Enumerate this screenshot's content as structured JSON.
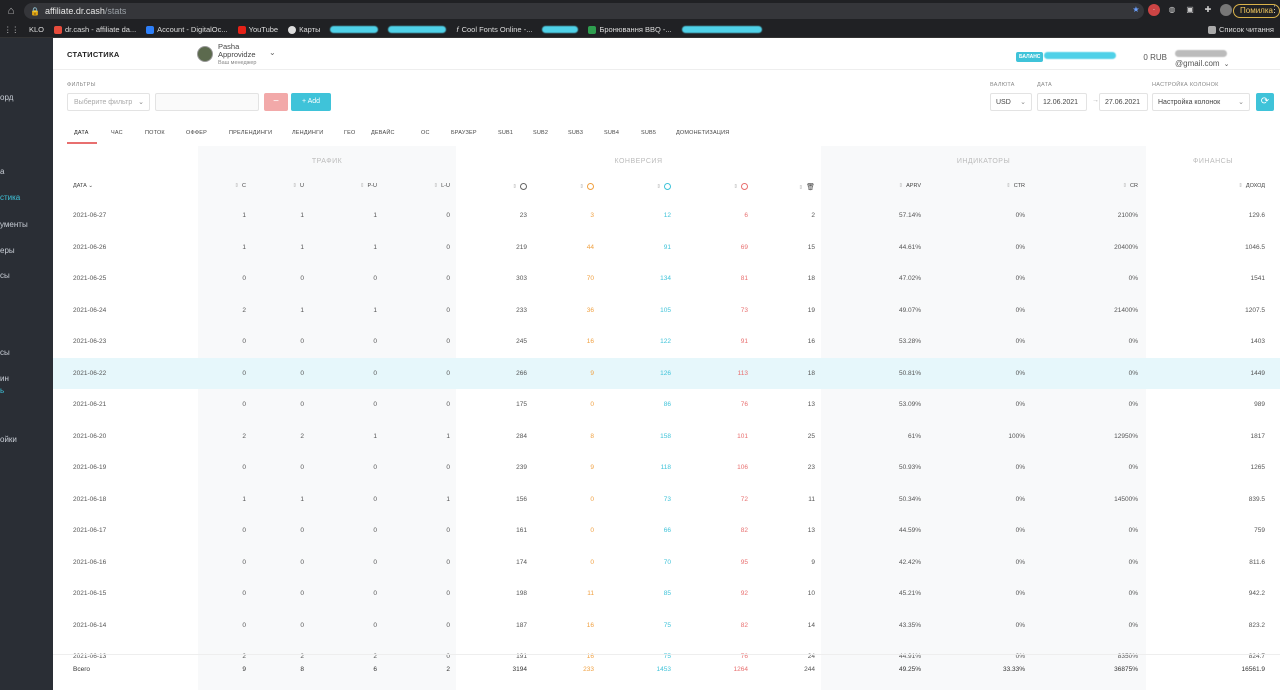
{
  "browser": {
    "url_host": "affiliate.dr.cash",
    "url_path": "/stats",
    "pause_label": "Помилка",
    "bookmarks": [
      "KLO",
      "dr.cash - affiliate da...",
      "Account - DigitalOc...",
      "YouTube",
      "Карты",
      "Cool Fonts Online -...",
      "Бронювання ВВQ -..."
    ],
    "reading_list": "Список читання"
  },
  "sidebar": {
    "items": [
      "орд",
      "а",
      "стика",
      "ументы",
      "еры",
      "сы",
      "сы",
      "ин",
      "ь",
      "ойки"
    ]
  },
  "header": {
    "title": "СТАТИСТИКА",
    "manager_name": "Pasha Approvidze",
    "manager_sub": "Ваш менеджер",
    "balance_label": "БАЛАНС",
    "balance_value": "0 RUB",
    "email": "@gmail.com"
  },
  "filters": {
    "label": "ФИЛЬТРЫ",
    "select_placeholder": "Выберите фильтр",
    "minus": "−",
    "add": "+ Add",
    "currency_label": "ВАЛЮТА",
    "currency_value": "USD",
    "date_label": "ДАТА",
    "date_from": "12.06.2021",
    "date_to": "27.06.2021",
    "columns_label": "НАСТРОЙКА КОЛОНОК",
    "columns_value": "Настройка колонок",
    "refresh": "⟳"
  },
  "tabs": [
    "ДАТА",
    "ЧАС",
    "ПОТОК",
    "ОФФЕР",
    "ПРЕЛЕНДИНГИ",
    "ЛЕНДИНГИ",
    "ГЕО",
    "ДЕВАЙС",
    "ОС",
    "БРАУЗЕР",
    "SUB1",
    "SUB2",
    "SUB3",
    "SUB4",
    "SUB5",
    "ДОМОНЕТИЗАЦИЯ"
  ],
  "table": {
    "groups": [
      "ТРАФИК",
      "КОНВЕРСИЯ",
      "ИНДИКАТОРЫ",
      "ФИНАНСЫ"
    ],
    "headers": [
      "ДАТА",
      "C",
      "U",
      "P-U",
      "L-U",
      "",
      "",
      "",
      "",
      "",
      "APRV",
      "CTR",
      "CR",
      "ДОХОД"
    ],
    "rows": [
      [
        "2021-06-27",
        "1",
        "1",
        "1",
        "0",
        "23",
        "3",
        "12",
        "6",
        "2",
        "57.14%",
        "0%",
        "2100%",
        "129.6"
      ],
      [
        "2021-06-26",
        "1",
        "1",
        "1",
        "0",
        "219",
        "44",
        "91",
        "69",
        "15",
        "44.61%",
        "0%",
        "20400%",
        "1046.5"
      ],
      [
        "2021-06-25",
        "0",
        "0",
        "0",
        "0",
        "303",
        "70",
        "134",
        "81",
        "18",
        "47.02%",
        "0%",
        "0%",
        "1541"
      ],
      [
        "2021-06-24",
        "2",
        "1",
        "1",
        "0",
        "233",
        "36",
        "105",
        "73",
        "19",
        "49.07%",
        "0%",
        "21400%",
        "1207.5"
      ],
      [
        "2021-06-23",
        "0",
        "0",
        "0",
        "0",
        "245",
        "16",
        "122",
        "91",
        "16",
        "53.28%",
        "0%",
        "0%",
        "1403"
      ],
      [
        "2021-06-22",
        "0",
        "0",
        "0",
        "0",
        "266",
        "9",
        "126",
        "113",
        "18",
        "50.81%",
        "0%",
        "0%",
        "1449"
      ],
      [
        "2021-06-21",
        "0",
        "0",
        "0",
        "0",
        "175",
        "0",
        "86",
        "76",
        "13",
        "53.09%",
        "0%",
        "0%",
        "989"
      ],
      [
        "2021-06-20",
        "2",
        "2",
        "1",
        "1",
        "284",
        "8",
        "158",
        "101",
        "25",
        "61%",
        "100%",
        "12950%",
        "1817"
      ],
      [
        "2021-06-19",
        "0",
        "0",
        "0",
        "0",
        "239",
        "9",
        "118",
        "106",
        "23",
        "50.93%",
        "0%",
        "0%",
        "1265"
      ],
      [
        "2021-06-18",
        "1",
        "1",
        "0",
        "1",
        "156",
        "0",
        "73",
        "72",
        "11",
        "50.34%",
        "0%",
        "14500%",
        "839.5"
      ],
      [
        "2021-06-17",
        "0",
        "0",
        "0",
        "0",
        "161",
        "0",
        "66",
        "82",
        "13",
        "44.59%",
        "0%",
        "0%",
        "759"
      ],
      [
        "2021-06-16",
        "0",
        "0",
        "0",
        "0",
        "174",
        "0",
        "70",
        "95",
        "9",
        "42.42%",
        "0%",
        "0%",
        "811.6"
      ],
      [
        "2021-06-15",
        "0",
        "0",
        "0",
        "0",
        "198",
        "11",
        "85",
        "92",
        "10",
        "45.21%",
        "0%",
        "0%",
        "942.2"
      ],
      [
        "2021-06-14",
        "0",
        "0",
        "0",
        "0",
        "187",
        "16",
        "75",
        "82",
        "14",
        "43.35%",
        "0%",
        "0%",
        "823.2"
      ],
      [
        "2021-06-13",
        "2",
        "2",
        "2",
        "0",
        "191",
        "16",
        "75",
        "76",
        "24",
        "44.91%",
        "0%",
        "8350%",
        "824.7"
      ]
    ],
    "totals": [
      "Всего",
      "9",
      "8",
      "6",
      "2",
      "3194",
      "233",
      "1453",
      "1264",
      "244",
      "49.25%",
      "33.33%",
      "36875%",
      "16561.9"
    ]
  }
}
